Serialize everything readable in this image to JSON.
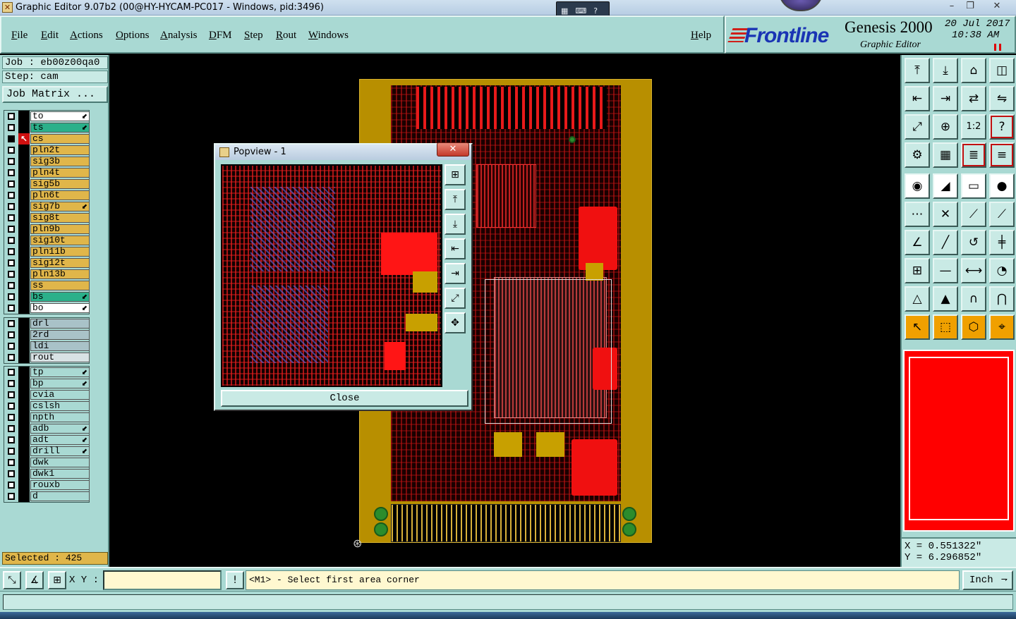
{
  "window": {
    "title": "Graphic Editor 9.07b2 (00@HY-HYCAM-PC017 - Windows, pid:3496)",
    "help_icon": "?"
  },
  "menu": {
    "items": [
      "File",
      "Edit",
      "Actions",
      "Options",
      "Analysis",
      "DFM",
      "Step",
      "Rout",
      "Windows"
    ],
    "help": "Help"
  },
  "brand": {
    "logo": "Frontline",
    "product": "Genesis 2000",
    "subtitle": "Graphic Editor",
    "date": "20 Jul 2017",
    "time": "10:38 AM"
  },
  "job": {
    "job_line": "Job : eb00z00qa0",
    "step_line": "Step: cam",
    "matrix_button": "Job Matrix ..."
  },
  "layers": {
    "board": [
      {
        "name": "to",
        "color": "#ffffff",
        "arrow": true
      },
      {
        "name": "ts",
        "color": "#2bb08a",
        "arrow": true
      },
      {
        "name": "cs",
        "color": "#e0b64a",
        "arrow": false,
        "active": true
      },
      {
        "name": "pln2t",
        "color": "#e0b64a"
      },
      {
        "name": "sig3b",
        "color": "#e0b64a"
      },
      {
        "name": "pln4t",
        "color": "#e0b64a"
      },
      {
        "name": "sig5b",
        "color": "#e0b64a"
      },
      {
        "name": "pln6t",
        "color": "#e0b64a"
      },
      {
        "name": "sig7b",
        "color": "#e0b64a",
        "arrow": true
      },
      {
        "name": "sig8t",
        "color": "#e0b64a"
      },
      {
        "name": "pln9b",
        "color": "#e0b64a"
      },
      {
        "name": "sig10t",
        "color": "#e0b64a"
      },
      {
        "name": "pln11b",
        "color": "#e0b64a"
      },
      {
        "name": "sig12t",
        "color": "#e0b64a"
      },
      {
        "name": "pln13b",
        "color": "#e0b64a"
      },
      {
        "name": "ss",
        "color": "#e0b64a"
      },
      {
        "name": "bs",
        "color": "#2bb08a",
        "arrow": true
      },
      {
        "name": "bo",
        "color": "#ffffff",
        "arrow": true
      }
    ],
    "drill": [
      {
        "name": "drl",
        "color": "#a9c2c8"
      },
      {
        "name": "2rd",
        "color": "#a9c2c8"
      },
      {
        "name": "ldi",
        "color": "#a9c2c8"
      },
      {
        "name": "rout",
        "color": "#d8e2e4"
      }
    ],
    "misc": [
      {
        "name": "tp",
        "color": "#a9d9d3",
        "arrow": true
      },
      {
        "name": "bp",
        "color": "#a9d9d3",
        "arrow": true
      },
      {
        "name": "cvia",
        "color": "#a9d9d3"
      },
      {
        "name": "cslsh",
        "color": "#a9d9d3"
      },
      {
        "name": "npth",
        "color": "#a9d9d3"
      },
      {
        "name": "adb",
        "color": "#a9d9d3",
        "arrow": true
      },
      {
        "name": "adt",
        "color": "#a9d9d3",
        "arrow": true
      },
      {
        "name": "drill",
        "color": "#a9d9d3",
        "arrow": true
      },
      {
        "name": "dwk",
        "color": "#a9d9d3"
      },
      {
        "name": "dwk1",
        "color": "#a9d9d3"
      },
      {
        "name": "rouxb",
        "color": "#a9d9d3"
      },
      {
        "name": "d",
        "color": "#a9d9d3"
      }
    ],
    "selected_text": "Selected : 425"
  },
  "popview": {
    "title": "Popview - 1",
    "close_button": "Close",
    "tools": [
      "zoom-fit-icon",
      "zoom-up-icon",
      "zoom-down-icon",
      "pan-left-icon",
      "pan-right-icon",
      "expand-icon",
      "move-icon"
    ]
  },
  "toolbox": {
    "tools": [
      [
        "import-icon",
        "⤒"
      ],
      [
        "export-icon",
        "⤓"
      ],
      [
        "home-icon",
        "⌂"
      ],
      [
        "window-icon",
        "◫"
      ],
      [
        "pan-left-icon",
        "⇤"
      ],
      [
        "pan-right-icon",
        "⇥"
      ],
      [
        "swap-icon",
        "⇄"
      ],
      [
        "mirror-icon",
        "⇋"
      ],
      [
        "fit-icon",
        "⤢"
      ],
      [
        "fit-center-icon",
        "⊕"
      ],
      [
        "scale-icon",
        "1:2"
      ],
      [
        "help-icon",
        "?"
      ],
      [
        "settings-icon",
        "⚙"
      ],
      [
        "grid-icon",
        "▦"
      ],
      [
        "layers-icon",
        "≣"
      ],
      [
        "layers-compare-icon",
        "≡"
      ],
      [
        "pad-icon",
        "◉"
      ],
      [
        "line-draw-icon",
        "◢"
      ],
      [
        "ruler-icon",
        "▭"
      ],
      [
        "circle-icon",
        "●"
      ],
      [
        "connect-icon",
        "⋯"
      ],
      [
        "cross-icon",
        "✕"
      ],
      [
        "segment-icon",
        "⟋"
      ],
      [
        "segment-red-icon",
        "⟋"
      ],
      [
        "angle-icon",
        "∠"
      ],
      [
        "slash-icon",
        "╱"
      ],
      [
        "arc-icon",
        "↺"
      ],
      [
        "split-icon",
        "╪"
      ],
      [
        "group-icon",
        "⊞"
      ],
      [
        "minus-icon",
        "—"
      ],
      [
        "measure-icon",
        "⟷"
      ],
      [
        "shapes-icon",
        "◔"
      ],
      [
        "triangle-icon",
        "△"
      ],
      [
        "triangle-up-icon",
        "▲"
      ],
      [
        "arch-icon",
        "∩"
      ],
      [
        "arch-fill-icon",
        "⋂"
      ],
      [
        "select-icon",
        "↖"
      ],
      [
        "select-box-icon",
        "⬚"
      ],
      [
        "select-poly-icon",
        "⬡"
      ],
      [
        "snap-icon",
        "⌖"
      ]
    ]
  },
  "coords": {
    "x": "X = 0.551322\"",
    "y": "Y = 6.296852\""
  },
  "cmdline": {
    "xy_label": "X Y :",
    "xy_value": "",
    "prompt": "<M1> - Select first area corner",
    "units": "Inch",
    "alert": "!"
  }
}
